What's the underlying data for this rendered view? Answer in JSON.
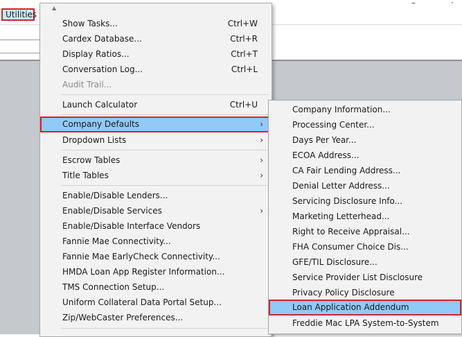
{
  "menubar": {
    "utilities": "Utilities"
  },
  "main_menu": {
    "items": [
      {
        "label": "Show Tasks...",
        "shortcut": "Ctrl+W"
      },
      {
        "label": "Cardex Database...",
        "shortcut": "Ctrl+R"
      },
      {
        "label": "Display Ratios...",
        "shortcut": "Ctrl+T"
      },
      {
        "label": "Conversation Log...",
        "shortcut": "Ctrl+L"
      },
      {
        "label": "Audit Trail...",
        "shortcut": ""
      },
      {
        "label": "Launch Calculator",
        "shortcut": "Ctrl+U"
      },
      {
        "label": "Company Defaults",
        "shortcut": ""
      },
      {
        "label": "Dropdown Lists",
        "shortcut": ""
      },
      {
        "label": "Escrow Tables",
        "shortcut": ""
      },
      {
        "label": "Title Tables",
        "shortcut": ""
      },
      {
        "label": "Enable/Disable Lenders...",
        "shortcut": ""
      },
      {
        "label": "Enable/Disable Services",
        "shortcut": ""
      },
      {
        "label": "Enable/Disable Interface Vendors",
        "shortcut": ""
      },
      {
        "label": "Fannie Mae Connectivity...",
        "shortcut": ""
      },
      {
        "label": "Fannie Mae EarlyCheck Connectivity...",
        "shortcut": ""
      },
      {
        "label": "HMDA Loan App Register Information...",
        "shortcut": ""
      },
      {
        "label": "TMS Connection Setup...",
        "shortcut": ""
      },
      {
        "label": "Uniform Collateral Data Portal Setup...",
        "shortcut": ""
      },
      {
        "label": "Zip/WebCaster Preferences...",
        "shortcut": ""
      }
    ]
  },
  "sub_menu": {
    "items": [
      {
        "label": "Company Information..."
      },
      {
        "label": "Processing Center..."
      },
      {
        "label": "Days Per Year..."
      },
      {
        "label": "ECOA Address..."
      },
      {
        "label": "CA Fair Lending Address..."
      },
      {
        "label": "Denial Letter Address..."
      },
      {
        "label": "Servicing Disclosure Info..."
      },
      {
        "label": "Marketing Letterhead..."
      },
      {
        "label": "Right to Receive Appraisal..."
      },
      {
        "label": "FHA Consumer Choice Dis..."
      },
      {
        "label": "GFE/TIL Disclosure..."
      },
      {
        "label": "Service Provider List Disclosure"
      },
      {
        "label": "Privacy Policy Disclosure"
      },
      {
        "label": "Loan Application Addendum"
      },
      {
        "label": "Freddie Mac LPA System-to-System"
      }
    ]
  },
  "icons": {
    "submenu_arrow": "chevron-right-icon",
    "scroll_up": "triangle-up-icon"
  },
  "colors": {
    "highlight": "#91c9f7",
    "callout_border": "#d9202a",
    "menu_bg": "#f2f2f2"
  }
}
